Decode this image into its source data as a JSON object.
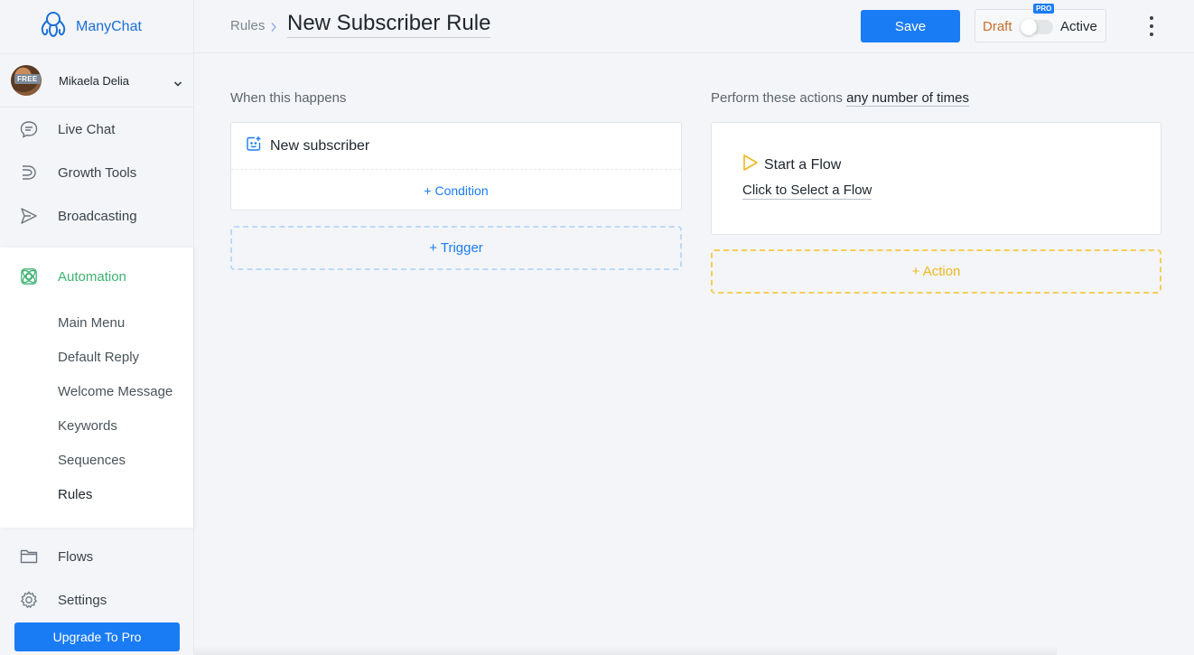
{
  "app": {
    "name": "ManyChat",
    "brand_color": "#1b6fd8"
  },
  "account": {
    "name": "Mikaela Delia",
    "plan_badge": "FREE"
  },
  "sidebar": {
    "items": [
      {
        "label": "Live Chat",
        "icon": "chat-bubble-icon"
      },
      {
        "label": "Growth Tools",
        "icon": "growth-tools-icon"
      },
      {
        "label": "Broadcasting",
        "icon": "send-icon"
      }
    ],
    "automation": {
      "label": "Automation",
      "icon": "automation-atom-icon",
      "color": "#3cb371",
      "sub_items": [
        "Main Menu",
        "Default Reply",
        "Welcome Message",
        "Keywords",
        "Sequences",
        "Rules"
      ],
      "active_sub_item": "Rules"
    },
    "bottom_items": [
      {
        "label": "Flows",
        "icon": "folder-icon"
      },
      {
        "label": "Settings",
        "icon": "gear-icon"
      }
    ],
    "upgrade_label": "Upgrade To Pro"
  },
  "header": {
    "breadcrumb_root": "Rules",
    "title": "New Subscriber Rule",
    "save_label": "Save",
    "draft_label": "Draft",
    "active_label": "Active",
    "pro_badge": "PRO",
    "toggle_on": false
  },
  "trigger_column": {
    "label": "When this happens",
    "trigger_title": "New subscriber",
    "condition_label": "+ Condition",
    "add_trigger_label": "+ Trigger"
  },
  "action_column": {
    "label_prefix": "Perform these actions",
    "label_link": "any number of times",
    "action_title": "Start a Flow",
    "select_flow_label": "Click to Select a Flow",
    "add_action_label": "+ Action",
    "accent_color": "#efb61c"
  }
}
